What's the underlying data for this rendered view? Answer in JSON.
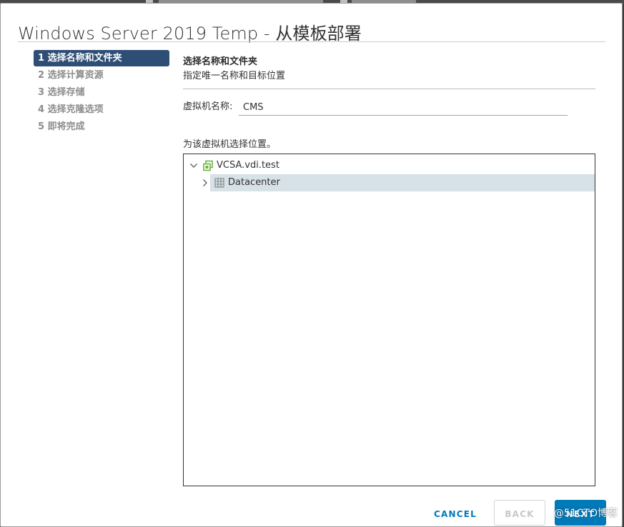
{
  "dialog": {
    "title": "Windows Server 2019 Temp - 从模板部署"
  },
  "steps": [
    {
      "label": "1 选择名称和文件夹",
      "active": true
    },
    {
      "label": "2 选择计算资源",
      "active": false
    },
    {
      "label": "3 选择存储",
      "active": false
    },
    {
      "label": "4 选择克隆选项",
      "active": false
    },
    {
      "label": "5 即将完成",
      "active": false
    }
  ],
  "section": {
    "title": "选择名称和文件夹",
    "subtitle": "指定唯一名称和目标位置"
  },
  "vm_name": {
    "label": "虚拟机名称:",
    "value": "CMS"
  },
  "location": {
    "label": "为该虚拟机选择位置。",
    "tree": [
      {
        "label": "VCSA.vdi.test",
        "icon": "vcenter-icon",
        "expanded": true,
        "selected": false,
        "level": 0
      },
      {
        "label": "Datacenter",
        "icon": "datacenter-icon",
        "expanded": false,
        "selected": true,
        "level": 1
      }
    ]
  },
  "footer": {
    "cancel_label": "CANCEL",
    "back_label": "BACK",
    "next_label": "NEXT"
  },
  "watermark": "@51CTO博客",
  "colors": {
    "active_step_bg": "#2f4e76",
    "primary_button": "#0079b8",
    "selected_row_bg": "#d6e1e8",
    "vcenter_icon": "#6db33f"
  }
}
